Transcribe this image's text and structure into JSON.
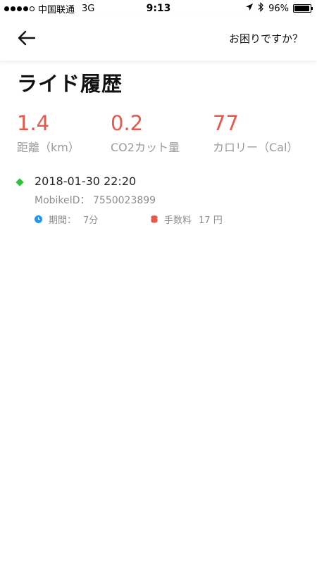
{
  "status_bar": {
    "carrier": "中国联通",
    "network": "3G",
    "time": "9:13",
    "battery": "96%",
    "battery_level": 0.96
  },
  "nav": {
    "back_icon": "back-arrow-icon",
    "help_link": "お困りですか？"
  },
  "page": {
    "title": "ライド履歴"
  },
  "stats": [
    {
      "value": "1.4",
      "label": "距離（km）"
    },
    {
      "value": "0.2",
      "label": "CO2カット量"
    },
    {
      "value": "77",
      "label": "カロリー（Cal）"
    }
  ],
  "rides": [
    {
      "datetime": "2018-01-30 22:20",
      "bike_id": "MobikeID： 7550023899",
      "duration_label": "期間：",
      "duration_value": "7分",
      "fee_label": "手数料",
      "fee_value": "17 円"
    }
  ],
  "colors": {
    "accent": "#e8574a",
    "marker": "#2ec23a",
    "clock_icon": "#2196f3",
    "fee_icon": "#e8574a"
  }
}
